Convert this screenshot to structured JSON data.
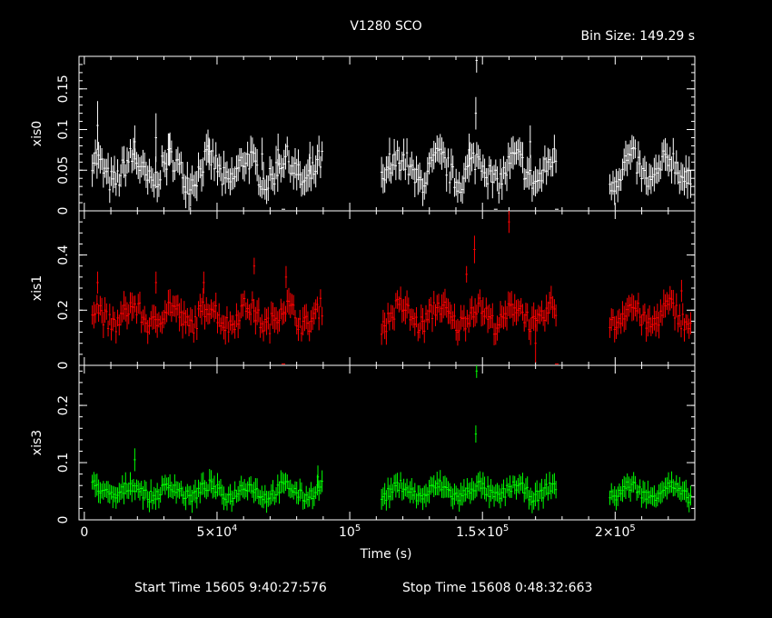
{
  "chart_data": {
    "type": "scatter",
    "title": "V1280 SCO",
    "bin_size_label": "Bin Size: 149.29 s",
    "xlabel": "Time (s)",
    "xlim": [
      -2000,
      230000
    ],
    "x_ticks": [
      {
        "value": 0,
        "label": "0"
      },
      {
        "value": 50000,
        "label": "5×10",
        "sup": "4"
      },
      {
        "value": 100000,
        "label": "10",
        "sup": "5"
      },
      {
        "value": 150000,
        "label": "1.5×10",
        "sup": "5"
      },
      {
        "value": 200000,
        "label": "2×10",
        "sup": "5"
      }
    ],
    "start_time": "Start Time 15605  9:40:27:576",
    "stop_time": "Stop Time 15608  0:48:32:663",
    "panels": [
      {
        "name": "xis0",
        "ylabel": "xis0",
        "color": "#ffffff",
        "ylim": [
          0,
          0.19
        ],
        "y_ticks": [
          {
            "value": 0,
            "label": "0"
          },
          {
            "value": 0.05,
            "label": "0.05"
          },
          {
            "value": 0.1,
            "label": "0.1"
          },
          {
            "value": 0.15,
            "label": "0.15"
          }
        ],
        "base": 0.05,
        "amp": 0.03,
        "err": 0.016,
        "spikes": [
          {
            "x": 5000,
            "y": 0.105,
            "err": 0.03
          },
          {
            "x": 19000,
            "y": 0.085,
            "err": 0.02
          },
          {
            "x": 27000,
            "y": 0.09,
            "err": 0.03
          },
          {
            "x": 32000,
            "y": 0.075,
            "err": 0.02
          },
          {
            "x": 47000,
            "y": 0.07,
            "err": 0.02
          },
          {
            "x": 67000,
            "y": 0.07,
            "err": 0.02
          },
          {
            "x": 73000,
            "y": 0.075,
            "err": 0.02
          },
          {
            "x": 85000,
            "y": 0.065,
            "err": 0.02
          },
          {
            "x": 147500,
            "y": 0.12,
            "err": 0.02
          },
          {
            "x": 147800,
            "y": 0.185,
            "err": 0.015
          },
          {
            "x": 145000,
            "y": 0.075,
            "err": 0.02
          },
          {
            "x": 168000,
            "y": 0.085,
            "err": 0.02
          },
          {
            "x": 115000,
            "y": 0.07,
            "err": 0.02
          }
        ],
        "outliers": [
          {
            "x": 75000,
            "y": 0.002
          },
          {
            "x": 155000,
            "y": 0.002
          },
          {
            "x": 178000,
            "y": 0.002
          }
        ]
      },
      {
        "name": "xis1",
        "ylabel": "xis1",
        "color": "#ff0000",
        "ylim": [
          0,
          0.56
        ],
        "y_ticks": [
          {
            "value": 0,
            "label": "0"
          },
          {
            "value": 0.2,
            "label": "0.2"
          },
          {
            "value": 0.4,
            "label": "0.4"
          }
        ],
        "base": 0.18,
        "amp": 0.07,
        "err": 0.04,
        "spikes": [
          {
            "x": 5000,
            "y": 0.3,
            "err": 0.04
          },
          {
            "x": 27000,
            "y": 0.3,
            "err": 0.04
          },
          {
            "x": 45000,
            "y": 0.3,
            "err": 0.04
          },
          {
            "x": 64000,
            "y": 0.36,
            "err": 0.03
          },
          {
            "x": 76000,
            "y": 0.32,
            "err": 0.04
          },
          {
            "x": 147000,
            "y": 0.42,
            "err": 0.05
          },
          {
            "x": 144000,
            "y": 0.33,
            "err": 0.03
          },
          {
            "x": 160000,
            "y": 0.52,
            "err": 0.04
          },
          {
            "x": 170000,
            "y": 0.08,
            "err": 0.07
          },
          {
            "x": 225000,
            "y": 0.27,
            "err": 0.04
          }
        ],
        "outliers": [
          {
            "x": 75000,
            "y": 0.005
          },
          {
            "x": 178000,
            "y": 0.005
          }
        ]
      },
      {
        "name": "xis3",
        "ylabel": "xis3",
        "color": "#00ff00",
        "ylim": [
          0,
          0.27
        ],
        "y_ticks": [
          {
            "value": 0,
            "label": "0"
          },
          {
            "value": 0.1,
            "label": "0.1"
          },
          {
            "value": 0.2,
            "label": "0.2"
          }
        ],
        "base": 0.05,
        "amp": 0.02,
        "err": 0.016,
        "spikes": [
          {
            "x": 19000,
            "y": 0.105,
            "err": 0.02
          },
          {
            "x": 147500,
            "y": 0.15,
            "err": 0.015
          },
          {
            "x": 147800,
            "y": 0.26,
            "err": 0.012
          },
          {
            "x": 88000,
            "y": 0.075,
            "err": 0.02
          }
        ],
        "outliers": []
      }
    ],
    "segments": [
      [
        3000,
        90000
      ],
      [
        112000,
        178000
      ],
      [
        198000,
        229000
      ]
    ],
    "grid": false
  }
}
